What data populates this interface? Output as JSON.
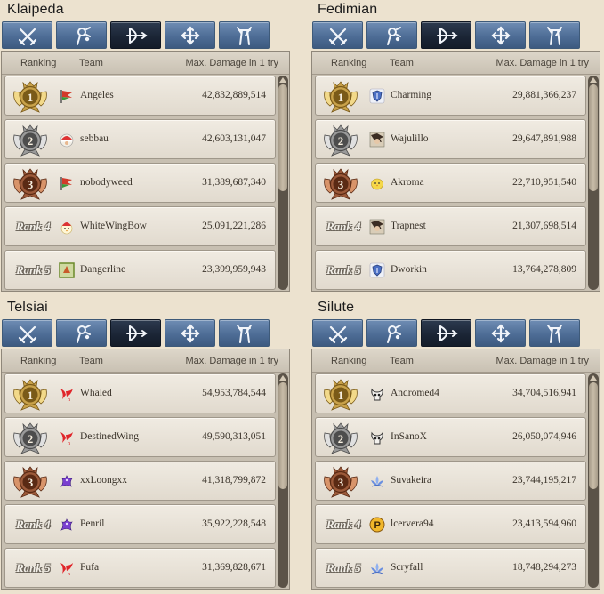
{
  "headers": {
    "ranking": "Ranking",
    "team": "Team",
    "damage": "Max. Damage in 1 try"
  },
  "tabs": [
    {
      "icon": "swords-icon"
    },
    {
      "icon": "wizard-staff-icon"
    },
    {
      "icon": "bow-icon"
    },
    {
      "icon": "cross-cleric-icon"
    },
    {
      "icon": "scout-tower-icon"
    }
  ],
  "selected_tab": 2,
  "colors": {
    "tab_bg": "#4e6d96",
    "tab_selected_bg": "#1a2434",
    "row_bg": "#e9e3d8",
    "gold": "#c9a24a",
    "silver": "#9a9a9a",
    "bronze": "#9c5a3a"
  },
  "panels": [
    {
      "server": "Klaipeda",
      "rows": [
        {
          "rank_label": "1",
          "medal": "gold",
          "emblem": "red-green-flag-icon",
          "team": "Angeles",
          "damage": "42,832,889,514"
        },
        {
          "rank_label": "2",
          "medal": "silver",
          "emblem": "santa-hat-icon",
          "team": "sebbau",
          "damage": "42,603,131,047"
        },
        {
          "rank_label": "3",
          "medal": "bronze",
          "emblem": "red-green-flag-icon",
          "team": "nobodyweed",
          "damage": "31,389,687,340"
        },
        {
          "rank_label": "Rank 4",
          "medal": "none",
          "emblem": "santa-chick-icon",
          "team": "WhiteWingBow",
          "damage": "25,091,221,286"
        },
        {
          "rank_label": "Rank 5",
          "medal": "none",
          "emblem": "green-frame-icon",
          "team": "Dangerline",
          "damage": "23,399,959,943"
        }
      ]
    },
    {
      "server": "Fedimian",
      "rows": [
        {
          "rank_label": "1",
          "medal": "gold",
          "emblem": "blue-shield-icon",
          "team": "Charming",
          "damage": "29,881,366,237"
        },
        {
          "rank_label": "2",
          "medal": "silver",
          "emblem": "character-portrait-icon",
          "team": "Wajulillo",
          "damage": "29,647,891,988"
        },
        {
          "rank_label": "3",
          "medal": "bronze",
          "emblem": "yellow-chick-icon",
          "team": "Akroma",
          "damage": "22,710,951,540"
        },
        {
          "rank_label": "Rank 4",
          "medal": "none",
          "emblem": "character-portrait-icon",
          "team": "Trapnest",
          "damage": "21,307,698,514"
        },
        {
          "rank_label": "Rank 5",
          "medal": "none",
          "emblem": "blue-shield-icon",
          "team": "Dworkin",
          "damage": "13,764,278,809"
        }
      ]
    },
    {
      "server": "Telsiai",
      "rows": [
        {
          "rank_label": "1",
          "medal": "gold",
          "emblem": "red-wing-icon",
          "team": "Whaled",
          "damage": "54,953,784,544"
        },
        {
          "rank_label": "2",
          "medal": "silver",
          "emblem": "red-wing-icon",
          "team": "DestinedWing",
          "damage": "49,590,313,051"
        },
        {
          "rank_label": "3",
          "medal": "bronze",
          "emblem": "purple-dragon-icon",
          "team": "xxLoongxx",
          "damage": "41,318,799,872"
        },
        {
          "rank_label": "Rank 4",
          "medal": "none",
          "emblem": "purple-dragon-icon",
          "team": "Penril",
          "damage": "35,922,228,548"
        },
        {
          "rank_label": "Rank 5",
          "medal": "none",
          "emblem": "red-wing-icon",
          "team": "Fufa",
          "damage": "31,369,828,671"
        }
      ]
    },
    {
      "server": "Silute",
      "rows": [
        {
          "rank_label": "1",
          "medal": "gold",
          "emblem": "horned-skull-icon",
          "team": "Andromed4",
          "damage": "34,704,516,941"
        },
        {
          "rank_label": "2",
          "medal": "silver",
          "emblem": "horned-skull-icon",
          "team": "InSanoX",
          "damage": "26,050,074,946"
        },
        {
          "rank_label": "3",
          "medal": "bronze",
          "emblem": "blue-lotus-icon",
          "team": "Suvakeira",
          "damage": "23,744,195,217"
        },
        {
          "rank_label": "Rank 4",
          "medal": "none",
          "emblem": "p-coin-icon",
          "team": "lcervera94",
          "damage": "23,413,594,960"
        },
        {
          "rank_label": "Rank 5",
          "medal": "none",
          "emblem": "blue-lotus-icon",
          "team": "Scryfall",
          "damage": "18,748,294,273"
        }
      ]
    }
  ]
}
